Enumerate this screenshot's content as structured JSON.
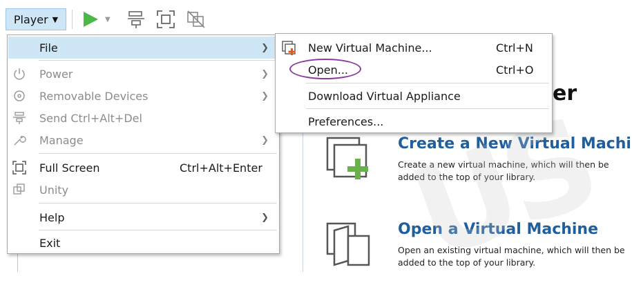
{
  "toolbar": {
    "player_label": "Player",
    "icons": [
      "play-icon",
      "dropdown-icon",
      "send-ctrl-alt-del-icon",
      "full-screen-icon",
      "unity-icon"
    ]
  },
  "player_menu": {
    "items": [
      {
        "label": "File",
        "shortcut": "",
        "submenu": true,
        "enabled": true,
        "active": true,
        "icon": ""
      },
      {
        "label": "Power",
        "shortcut": "",
        "submenu": true,
        "enabled": false,
        "icon": "power-icon"
      },
      {
        "label": "Removable Devices",
        "shortcut": "",
        "submenu": true,
        "enabled": false,
        "icon": "disc-icon"
      },
      {
        "label": "Send Ctrl+Alt+Del",
        "shortcut": "",
        "submenu": false,
        "enabled": false,
        "icon": "send-keys-icon"
      },
      {
        "label": "Manage",
        "shortcut": "",
        "submenu": true,
        "enabled": false,
        "icon": "wrench-icon"
      },
      {
        "label": "Full Screen",
        "shortcut": "Ctrl+Alt+Enter",
        "submenu": false,
        "enabled": true,
        "icon": "full-screen-icon"
      },
      {
        "label": "Unity",
        "shortcut": "",
        "submenu": false,
        "enabled": false,
        "icon": "unity-icon"
      },
      {
        "label": "Help",
        "shortcut": "",
        "submenu": true,
        "enabled": true,
        "icon": ""
      },
      {
        "label": "Exit",
        "shortcut": "",
        "submenu": false,
        "enabled": true,
        "icon": ""
      }
    ]
  },
  "file_submenu": {
    "items": [
      {
        "label": "New Virtual Machine...",
        "shortcut": "Ctrl+N",
        "icon": "new-vm-icon"
      },
      {
        "label": "Open...",
        "shortcut": "Ctrl+O",
        "icon": ""
      },
      {
        "label": "Download Virtual Appliance",
        "shortcut": "",
        "icon": ""
      },
      {
        "label": "Preferences...",
        "shortcut": "",
        "icon": ""
      }
    ]
  },
  "home": {
    "title_fragment": "er",
    "create": {
      "title": "Create a New Virtual Machine",
      "desc": "Create a new virtual machine, which will then be added to the top of your library."
    },
    "open": {
      "title": "Open a Virtual Machine",
      "desc": "Open an existing virtual machine, which will then be added to the top of your library."
    }
  },
  "colors": {
    "accent_blue": "#1f5f9e",
    "highlight": "#cfe6f7",
    "play_green": "#4cb848",
    "annotation_purple": "#8a3a9e"
  }
}
